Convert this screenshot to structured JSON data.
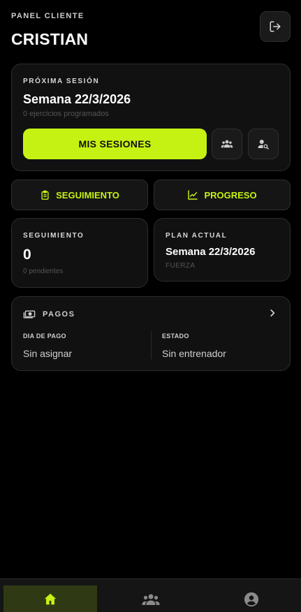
{
  "header": {
    "eyebrow": "PANEL CLIENTE",
    "name": "CRISTIAN"
  },
  "next_session": {
    "label": "PRÓXIMA SESIÓN",
    "week": "Semana 22/3/2026",
    "sub": "0 ejercicios programados",
    "button": "MIS SESIONES"
  },
  "actions": {
    "seguimiento": "SEGUIMIENTO",
    "progreso": "PROGRESO"
  },
  "tracking": {
    "label": "SEGUIMIENTO",
    "value": "0",
    "sub": "0 pendientes"
  },
  "plan": {
    "label": "PLAN ACTUAL",
    "value": "Semana 22/3/2026",
    "sub": "FUERZA"
  },
  "payments": {
    "label": "PAGOS",
    "pay_day_label": "DIA DE PAGO",
    "pay_day_value": "Sin asignar",
    "status_label": "ESTADO",
    "status_value": "Sin entrenador"
  },
  "colors": {
    "accent": "#c6f213",
    "background": "#000000",
    "card": "#111111"
  },
  "icons": [
    "logout-icon",
    "group-icon",
    "user-search-icon",
    "clipboard-icon",
    "chart-line-icon",
    "money-icon",
    "chevron-right-icon",
    "home-icon",
    "team-icon",
    "account-icon"
  ]
}
